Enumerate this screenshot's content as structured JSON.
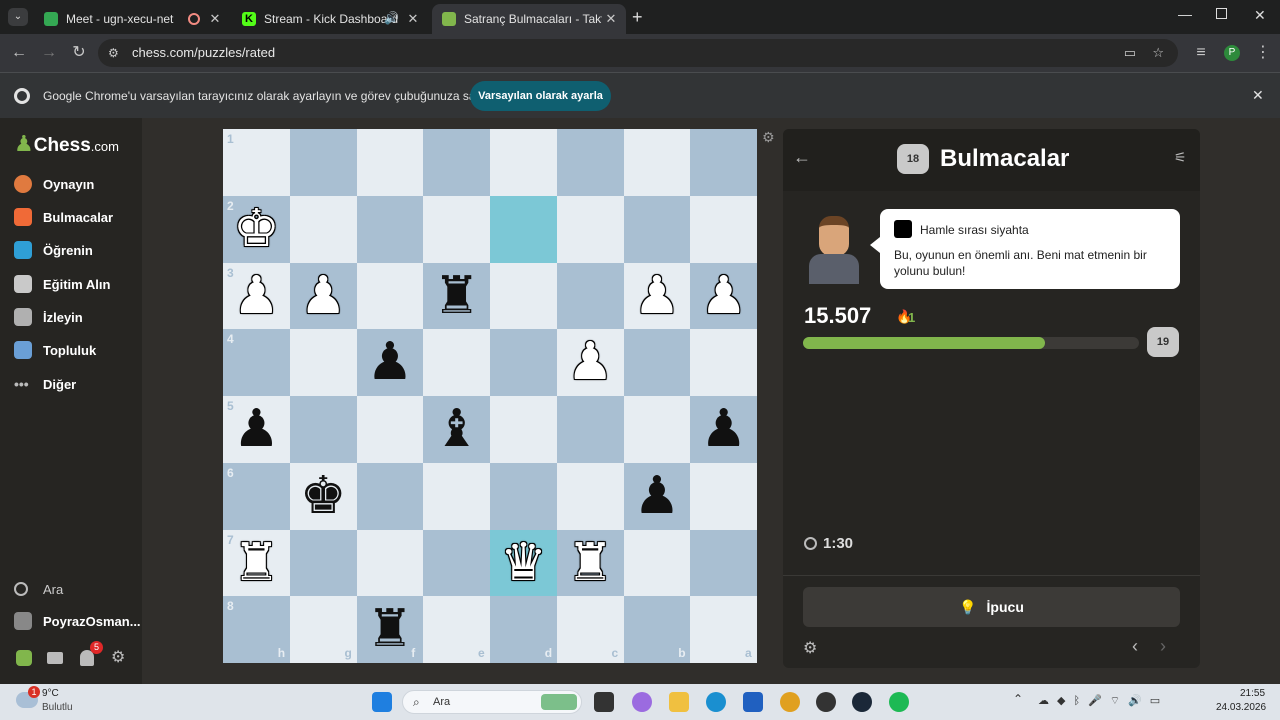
{
  "browser": {
    "tabs": [
      {
        "label": "Meet - ugn-xecu-net",
        "fav_color": "#34a853"
      },
      {
        "label": "Stream - Kick Dashboard",
        "fav_color": "#53fc18"
      },
      {
        "label": "Satranç Bulmacaları - Taktik Bul",
        "fav_color": "#8a8a8a"
      }
    ],
    "url": "chess.com/puzzles/rated",
    "profile_initial": "P",
    "infobar_text": "Google Chrome'u varsayılan tarayıcınız olarak ayarlayın ve görev çubuğunuza sabitleyin",
    "infobar_button": "Varsayılan olarak ayarla"
  },
  "sidebar": {
    "logo_text": "Chess",
    "logo_suffix": ".com",
    "items": [
      {
        "label": "Oynayın",
        "color": "#e07a3f"
      },
      {
        "label": "Bulmacalar",
        "color": "#f06a37"
      },
      {
        "label": "Öğrenin",
        "color": "#2f9fd6"
      },
      {
        "label": "Eğitim Alın",
        "color": "#c9c9c9"
      },
      {
        "label": "İzleyin",
        "color": "#b0b0b0"
      },
      {
        "label": "Topluluk",
        "color": "#6a9fd6"
      },
      {
        "label": "Diğer",
        "color": "#bbbbbb"
      }
    ],
    "search_label": "Ara",
    "username": "PoyrazOsman...",
    "notification_count": "5"
  },
  "board": {
    "ranks": [
      "1",
      "2",
      "3",
      "4",
      "5",
      "6",
      "7",
      "8"
    ],
    "files": [
      "h",
      "g",
      "f",
      "e",
      "d",
      "c",
      "b",
      "a"
    ],
    "pieces": [
      {
        "glyph": "♚",
        "color": "w",
        "col": 0,
        "row": 1
      },
      {
        "glyph": "♟",
        "color": "w",
        "col": 0,
        "row": 2
      },
      {
        "glyph": "♟",
        "color": "w",
        "col": 1,
        "row": 2
      },
      {
        "glyph": "♜",
        "color": "b",
        "col": 3,
        "row": 2
      },
      {
        "glyph": "♟",
        "color": "w",
        "col": 6,
        "row": 2
      },
      {
        "glyph": "♟",
        "color": "w",
        "col": 7,
        "row": 2
      },
      {
        "glyph": "♟",
        "color": "b",
        "col": 2,
        "row": 3
      },
      {
        "glyph": "♟",
        "color": "w",
        "col": 5,
        "row": 3
      },
      {
        "glyph": "♟",
        "color": "b",
        "col": 0,
        "row": 4
      },
      {
        "glyph": "♝",
        "color": "b",
        "col": 3,
        "row": 4
      },
      {
        "glyph": "♟",
        "color": "b",
        "col": 7,
        "row": 4
      },
      {
        "glyph": "♚",
        "color": "b",
        "col": 1,
        "row": 5
      },
      {
        "glyph": "♟",
        "color": "b",
        "col": 6,
        "row": 5
      },
      {
        "glyph": "♜",
        "color": "w",
        "col": 0,
        "row": 6
      },
      {
        "glyph": "♛",
        "color": "w",
        "col": 4,
        "row": 6
      },
      {
        "glyph": "♜",
        "color": "w",
        "col": 5,
        "row": 6
      },
      {
        "glyph": "♜",
        "color": "b",
        "col": 2,
        "row": 7
      }
    ],
    "highlights": [
      {
        "col": 4,
        "row": 1
      },
      {
        "col": 4,
        "row": 6
      }
    ]
  },
  "panel": {
    "title": "Bulmacalar",
    "badge_value": "18",
    "turn_text": "Hamle sırası siyahta",
    "message": "Bu, oyunun en önemli anı. Beni mat etmenin bir yolunu bulun!",
    "rating": "15.507",
    "streak": "1",
    "progress_percent": 72,
    "next_badge": "19",
    "timer": "1:30",
    "hint_label": "İpucu"
  },
  "taskbar": {
    "weather_temp": "9°C",
    "weather_desc": "Bulutlu",
    "weather_badge": "1",
    "search_label": "Ara",
    "time": "21:55",
    "date": "24.03.2026"
  }
}
